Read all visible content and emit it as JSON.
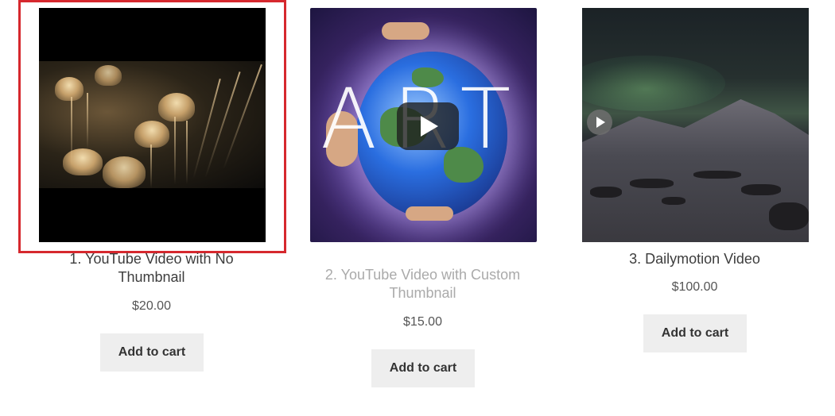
{
  "products": [
    {
      "title_line1": "1. YouTube Video with No",
      "title_line2": "Thumbnail",
      "price": "$20.00",
      "button": "Add to cart",
      "highlighted": true
    },
    {
      "title_line1": "2. YouTube Video with Custom",
      "title_line2": "Thumbnail",
      "price": "$15.00",
      "button": "Add to cart",
      "thumbnail_text": "ART"
    },
    {
      "title_line1": "3. Dailymotion Video",
      "price": "$100.00",
      "button": "Add to cart"
    }
  ],
  "colors": {
    "highlight": "#d6282e",
    "button_bg": "#eeeeee",
    "title_text": "#3d3d3d",
    "muted_title": "#aaaaaa"
  },
  "icons": {
    "youtube_play": "play-icon",
    "dailymotion_play": "play-icon"
  }
}
